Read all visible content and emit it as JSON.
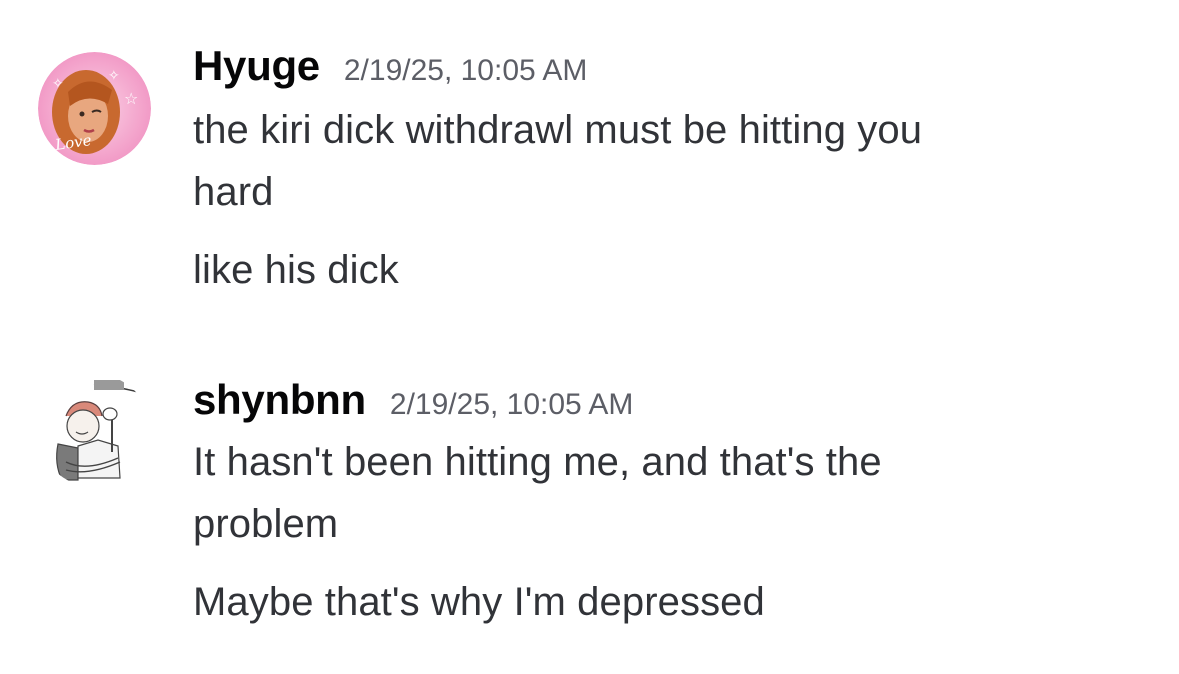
{
  "messages": [
    {
      "author": "Hyuge",
      "timestamp": "2/19/25, 10:05 AM",
      "avatar_icon": "anime-avatar-love-icon",
      "avatar_text": "Love",
      "lines": [
        "the kiri dick withdrawl must be hitting you",
        "hard",
        "like his dick"
      ]
    },
    {
      "author": "shynbnn",
      "timestamp": "2/19/25, 10:05 AM",
      "avatar_icon": "sketch-avatar-icon",
      "lines": [
        "It hasn't been hitting me, and that's the",
        "problem",
        "Maybe that's why I'm depressed"
      ]
    }
  ]
}
